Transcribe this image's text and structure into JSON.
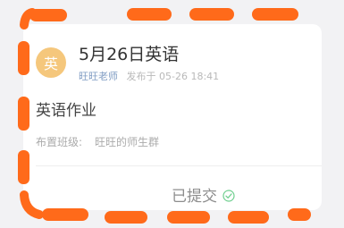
{
  "card": {
    "avatar_char": "英",
    "title": "5月26日英语",
    "teacher": "旺旺老师",
    "published": "发布于 05-26 18:41",
    "homework_title": "英语作业",
    "class_label": "布置班级:",
    "class_value": "旺旺的师生群",
    "status_text": "已提交",
    "status_icon": "check-circle-icon"
  },
  "colors": {
    "highlight": "#ff6a1a",
    "avatar": "#f5c77c",
    "teacher": "#7f9cc3",
    "check": "#6fcf8f"
  }
}
